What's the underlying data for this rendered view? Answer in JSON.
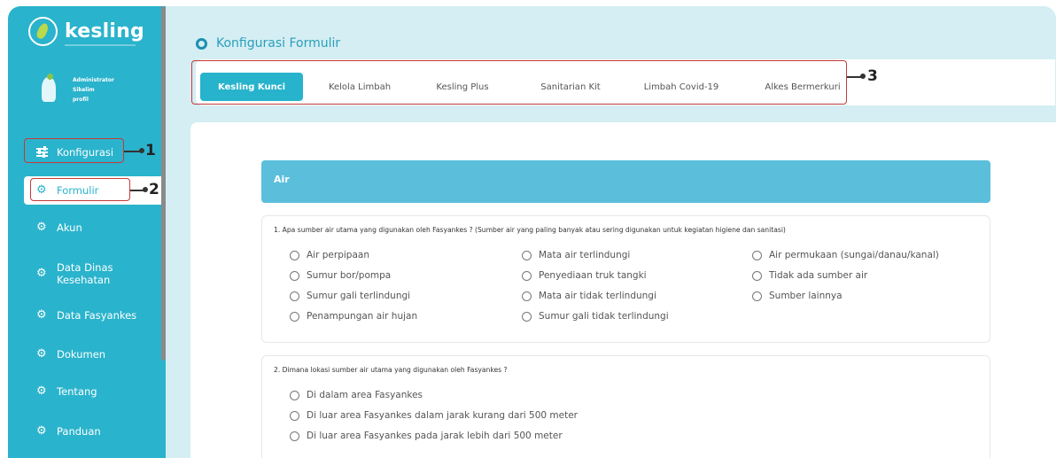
{
  "brand": {
    "name": "kesling"
  },
  "profile": {
    "role": "Administrator",
    "name": "Sikelim",
    "link": "profil"
  },
  "sidebar": {
    "items": [
      {
        "label": "Konfigurasi"
      },
      {
        "label": "Formulir"
      },
      {
        "label": "Akun"
      },
      {
        "label": "Data Dinas\nKesehatan"
      },
      {
        "label": "Data Fasyankes"
      },
      {
        "label": "Dokumen"
      },
      {
        "label": "Tentang"
      },
      {
        "label": "Panduan"
      }
    ]
  },
  "annotations": {
    "n1": "1",
    "n2": "2",
    "n3": "3"
  },
  "page": {
    "title": "Konfigurasi Formulir"
  },
  "tabs": [
    {
      "label": "Kesling Kunci"
    },
    {
      "label": "Kelola Limbah"
    },
    {
      "label": "Kesling Plus"
    },
    {
      "label": "Sanitarian Kit"
    },
    {
      "label": "Limbah Covid-19"
    },
    {
      "label": "Alkes Bermerkuri"
    }
  ],
  "section": {
    "title": "Air"
  },
  "questions": [
    {
      "text": "1. Apa sumber air utama yang digunakan oleh Fasyankes ? (Sumber air yang paling banyak atau sering digunakan untuk kegiatan higiene dan sanitasi)",
      "options": [
        "Air perpipaan",
        "Sumur bor/pompa",
        "Sumur gali terlindungi",
        "Penampungan air hujan",
        "Mata air terlindungi",
        "Penyediaan truk tangki",
        "Mata air tidak terlindungi",
        "Sumur gali tidak terlindungi",
        "Air permukaan (sungai/danau/kanal)",
        "Tidak ada sumber air",
        "Sumber lainnya"
      ]
    },
    {
      "text": "2. Dimana lokasi sumber air utama yang digunakan oleh Fasyankes ?",
      "options": [
        "Di dalam area Fasyankes",
        "Di luar area Fasyankes dalam jarak kurang dari 500 meter",
        "Di luar area Fasyankes pada jarak lebih dari 500 meter"
      ]
    }
  ],
  "colors": {
    "primary": "#2ab3cc",
    "section": "#5bbfdc",
    "background": "#d4eef3",
    "annotation": "#c43a3a"
  }
}
